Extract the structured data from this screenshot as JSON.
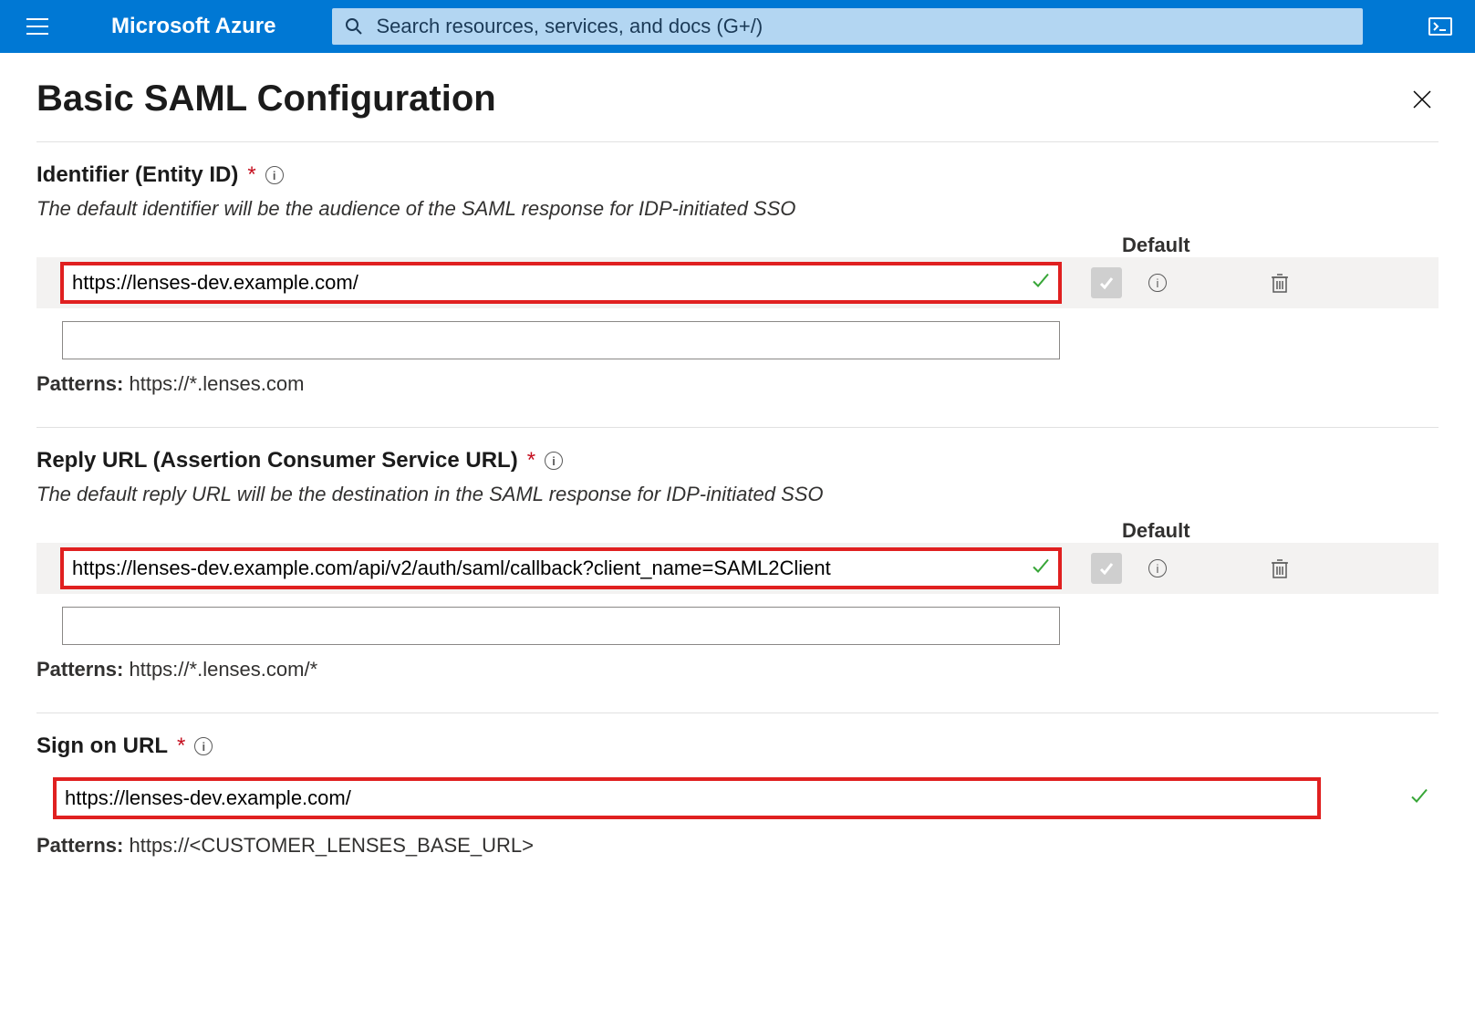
{
  "header": {
    "brand": "Microsoft Azure",
    "search_placeholder": "Search resources, services, and docs (G+/)"
  },
  "page": {
    "title": "Basic SAML Configuration"
  },
  "sections": {
    "identifier": {
      "label": "Identifier (Entity ID)",
      "description": "The default identifier will be the audience of the SAML response for IDP-initiated SSO",
      "default_header": "Default",
      "value": "https://lenses-dev.example.com/",
      "blank_value": "",
      "patterns_label": "Patterns:",
      "patterns_value": "https://*.lenses.com"
    },
    "reply_url": {
      "label": "Reply URL (Assertion Consumer Service URL)",
      "description": "The default reply URL will be the destination in the SAML response for IDP-initiated SSO",
      "default_header": "Default",
      "value": "https://lenses-dev.example.com/api/v2/auth/saml/callback?client_name=SAML2Client",
      "blank_value": "",
      "patterns_label": "Patterns:",
      "patterns_value": "https://*.lenses.com/*"
    },
    "sign_on_url": {
      "label": "Sign on URL",
      "value": "https://lenses-dev.example.com/",
      "patterns_label": "Patterns:",
      "patterns_value": "https://<CUSTOMER_LENSES_BASE_URL>"
    }
  }
}
